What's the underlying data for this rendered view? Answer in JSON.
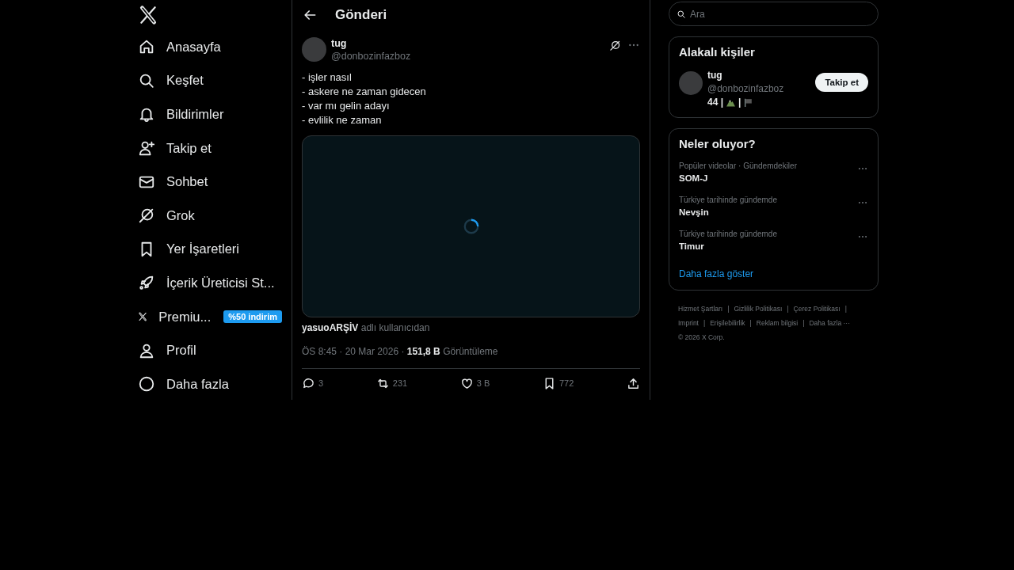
{
  "nav": {
    "items": [
      {
        "kind": "home",
        "label": "Anasayfa"
      },
      {
        "kind": "search",
        "label": "Keşfet"
      },
      {
        "kind": "bell",
        "label": "Bildirimler"
      },
      {
        "kind": "person-add",
        "label": "Takip et"
      },
      {
        "kind": "mail",
        "label": "Sohbet"
      },
      {
        "kind": "grok",
        "label": "Grok"
      },
      {
        "kind": "bookmark",
        "label": "Yer İşaretleri"
      },
      {
        "kind": "rocket",
        "label": "İçerik Üreticisi St..."
      },
      {
        "kind": "x",
        "label": "Premiu...",
        "badge": "%50 indirim"
      },
      {
        "kind": "person",
        "label": "Profil"
      },
      {
        "kind": "more",
        "label": "Daha fazla"
      }
    ]
  },
  "header": {
    "title": "Gönderi"
  },
  "post": {
    "name": "tug",
    "handle": "@donbozinfazboz",
    "lines": [
      "- işler nasıl",
      "- askere ne zaman gidecen",
      "- var mı gelin adayı",
      "- evlilik ne zaman"
    ],
    "media": {
      "kind": "video",
      "loading": true
    },
    "source": {
      "user": "yasuoARŞİV",
      "text": "adlı kullanıcıdan"
    },
    "meta": {
      "time": "ÖS 8:45 · 20 Mar 2026 ·",
      "views": "151,8 B",
      "views_label": "Görüntüleme"
    },
    "actions": [
      {
        "kind": "reply",
        "count": "3"
      },
      {
        "kind": "retweet",
        "count": "231"
      },
      {
        "kind": "like",
        "count": "3 B"
      },
      {
        "kind": "bookmark",
        "count": "772"
      },
      {
        "kind": "share"
      }
    ]
  },
  "search": {
    "placeholder": "Ara"
  },
  "related": {
    "title": "Alakalı kişiler",
    "name": "tug",
    "handle": "@donbozinfazboz",
    "bio_number": "44",
    "separator": "|",
    "button": "Takip et"
  },
  "trends": {
    "title": "Neler oluyor?",
    "items": [
      {
        "context": "Popüler videolar · Gündemdekiler",
        "name": "SOM-J"
      },
      {
        "context": "Türkiye tarihinde gündemde",
        "name": "Nevşin"
      },
      {
        "context": "Türkiye tarihinde gündemde",
        "name": "Timur"
      }
    ],
    "more": "Daha fazla göster"
  },
  "footer": {
    "links": [
      "Hizmet Şartları",
      "Gizlilik Politikası",
      "Çerez Politikası",
      "Imprint",
      "Erişilebilirlik",
      "Reklam bilgisi",
      "Daha fazla ···"
    ],
    "separator": "|",
    "copyright": "© 2026 X Corp."
  }
}
